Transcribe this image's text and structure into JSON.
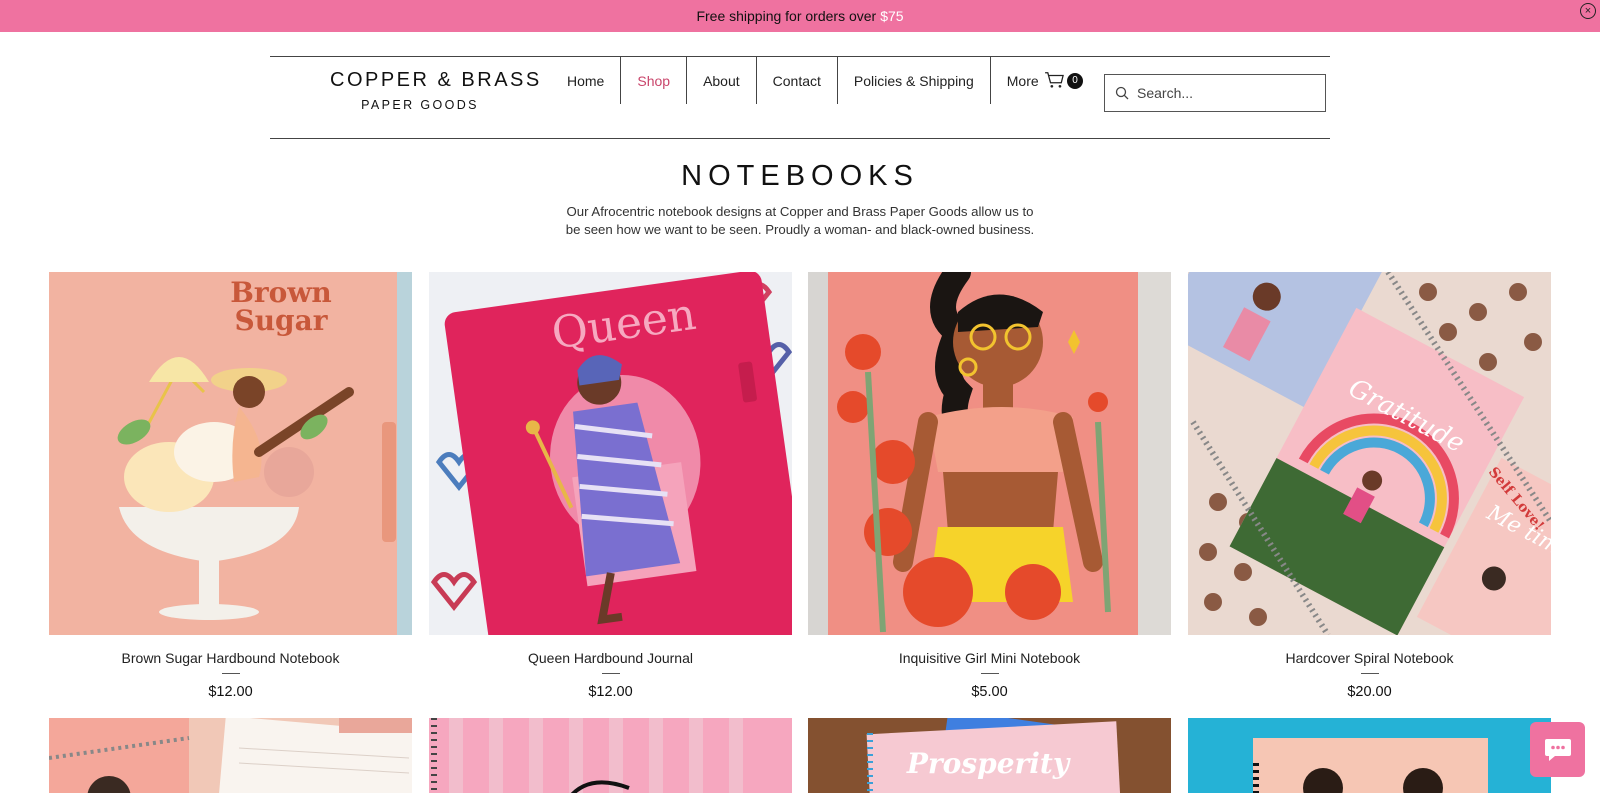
{
  "announcement": {
    "text": "Free shipping for orders over",
    "amount": "$75",
    "close_icon": "close-circle-icon"
  },
  "header": {
    "brand": "COPPER & BRASS",
    "brand_sub": "PAPER GOODS",
    "nav": [
      {
        "label": "Home",
        "active": false
      },
      {
        "label": "Shop",
        "active": true
      },
      {
        "label": "About",
        "active": false
      },
      {
        "label": "Contact",
        "active": false
      },
      {
        "label": "Policies & Shipping",
        "active": false
      },
      {
        "label": "More",
        "active": false
      }
    ],
    "cart_icon": "cart-icon",
    "cart_count": "0",
    "search_placeholder": "Search...",
    "active_color": "#c9456b"
  },
  "page": {
    "title": "NOTEBOOKS",
    "intro_line1": "Our Afrocentric notebook designs at Copper and Brass Paper Goods allow us to",
    "intro_line2": "be seen how we want to be seen. Proudly a woman- and black-owned business."
  },
  "products": [
    {
      "name": "Brown Sugar Hardbound Notebook",
      "price": "$12.00",
      "cover_text": "Brown Sugar"
    },
    {
      "name": "Queen Hardbound Journal",
      "price": "$12.00",
      "cover_text": "Queen"
    },
    {
      "name": "Inquisitive Girl Mini Notebook",
      "price": "$5.00",
      "cover_text": ""
    },
    {
      "name": "Hardcover Spiral Notebook",
      "price": "$20.00",
      "cover_text": "Gratitude / Self Love! / Me time"
    }
  ],
  "second_row": [
    {
      "cover_text": ""
    },
    {
      "cover_text": ""
    },
    {
      "cover_text": "Prosperity"
    },
    {
      "cover_text": ""
    }
  ],
  "colors": {
    "announcement_bg": "#ef72a0",
    "chat_bg": "#ef72a0"
  },
  "chat_icon": "chat-bubble-icon"
}
